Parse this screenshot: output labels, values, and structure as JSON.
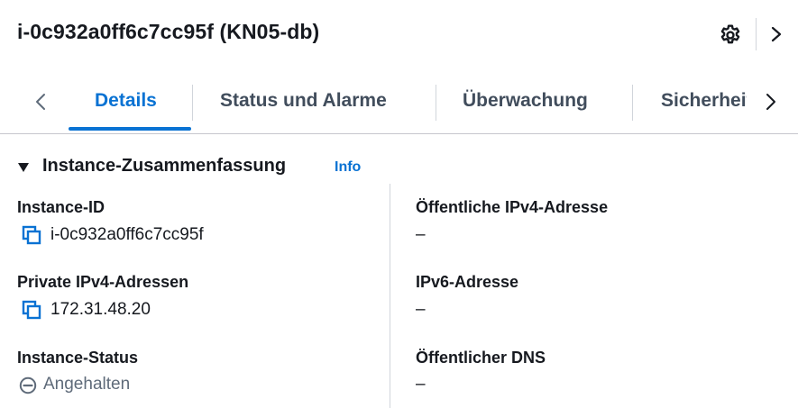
{
  "header": {
    "title": "i-0c932a0ff6c7cc95f (KN05-db)",
    "icons": [
      "gear-icon",
      "chevron-right-icon"
    ]
  },
  "tabs": {
    "items": [
      {
        "label": "Details",
        "active": true
      },
      {
        "label": "Status und Alarme",
        "active": false
      },
      {
        "label": "Überwachung",
        "active": false
      },
      {
        "label": "Sicherheit",
        "active": false
      }
    ]
  },
  "section": {
    "title": "Instance-Zusammenfassung",
    "info_link": "Info"
  },
  "left_column": {
    "instance_id": {
      "label": "Instance-ID",
      "value": "i-0c932a0ff6c7cc95f"
    },
    "private_ipv4": {
      "label": "Private IPv4-Adressen",
      "value": "172.31.48.20"
    },
    "instance_status": {
      "label": "Instance-Status",
      "value": "Angehalten"
    }
  },
  "right_column": {
    "public_ipv4": {
      "label": "Öffentliche IPv4-Adresse",
      "value": "–"
    },
    "ipv6": {
      "label": "IPv6-Adresse",
      "value": "–"
    },
    "public_dns": {
      "label": "Öffentlicher DNS",
      "value": "–"
    }
  },
  "colors": {
    "accent": "#0972d3",
    "text": "#16191f",
    "tab_text": "#414d5c",
    "muted": "#5f6b7a",
    "divider": "#d1d5db"
  }
}
